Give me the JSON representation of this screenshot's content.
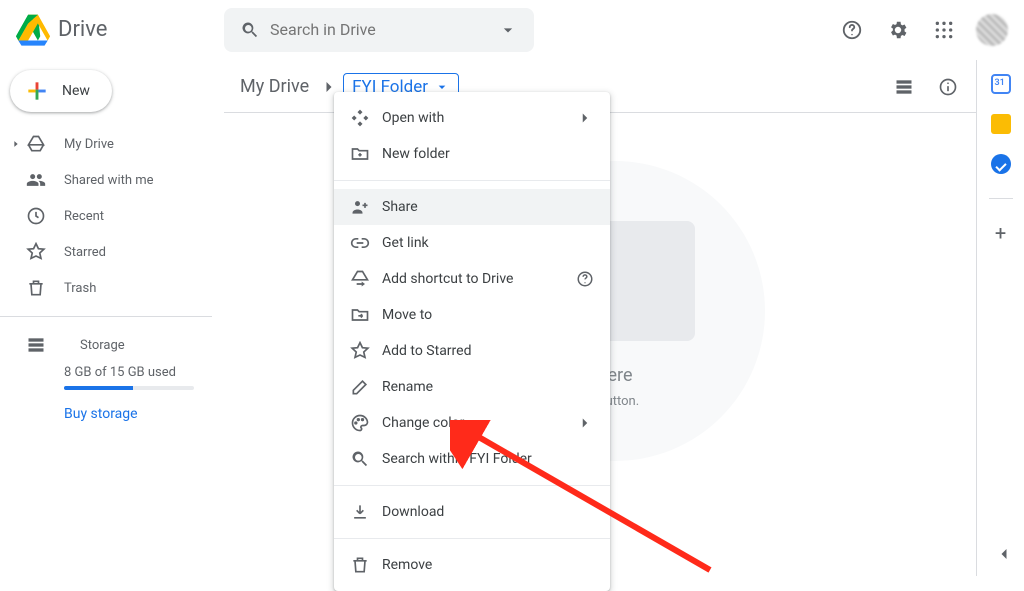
{
  "header": {
    "product_name": "Drive",
    "search_placeholder": "Search in Drive"
  },
  "new_button_label": "New",
  "sidebar": {
    "items": [
      {
        "label": "My Drive"
      },
      {
        "label": "Shared with me"
      },
      {
        "label": "Recent"
      },
      {
        "label": "Starred"
      },
      {
        "label": "Trash"
      }
    ],
    "storage_label": "Storage",
    "storage_used_text": "8 GB of 15 GB used",
    "buy_storage_label": "Buy storage"
  },
  "breadcrumb": {
    "root": "My Drive",
    "current": "FYI Folder"
  },
  "empty_state": {
    "line1_suffix": "here",
    "line2_suffix": "\" button."
  },
  "context_menu": {
    "open_with": "Open with",
    "new_folder": "New folder",
    "share": "Share",
    "get_link": "Get link",
    "add_shortcut": "Add shortcut to Drive",
    "move_to": "Move to",
    "add_to_starred": "Add to Starred",
    "rename": "Rename",
    "change_color": "Change color",
    "search_within": "Search within FYI Folder",
    "download": "Download",
    "remove": "Remove"
  },
  "right_rail": {
    "calendar": "Calendar",
    "keep": "Keep",
    "tasks": "Tasks",
    "add": "Get Add-ons"
  }
}
